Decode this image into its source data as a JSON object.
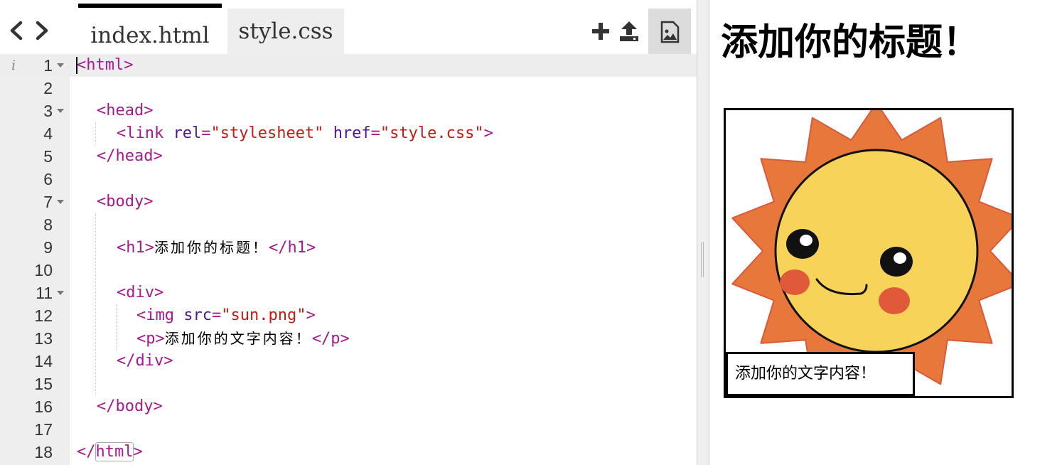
{
  "editor": {
    "tabs": [
      {
        "label": "index.html",
        "active": true
      },
      {
        "label": "style.css",
        "active": false
      }
    ],
    "toolbar": {
      "back_icon": "chevron-left-icon",
      "forward_icon": "chevron-right-icon",
      "add_icon": "plus-icon",
      "upload_icon": "upload-icon",
      "image_icon": "image-icon"
    },
    "info_marker": "i",
    "lines": [
      {
        "num": "1"
      },
      {
        "num": "2"
      },
      {
        "num": "3"
      },
      {
        "num": "4"
      },
      {
        "num": "5"
      },
      {
        "num": "6"
      },
      {
        "num": "7"
      },
      {
        "num": "8"
      },
      {
        "num": "9"
      },
      {
        "num": "10"
      },
      {
        "num": "11"
      },
      {
        "num": "12"
      },
      {
        "num": "13"
      },
      {
        "num": "14"
      },
      {
        "num": "15"
      },
      {
        "num": "16"
      },
      {
        "num": "17"
      },
      {
        "num": "18"
      }
    ],
    "code": {
      "l1_open": "<html>",
      "l3_head": "<head>",
      "l4_link_open": "<link",
      "l4_rel_attr": "rel",
      "l4_eq1": "=",
      "l4_rel_val": "\"stylesheet\"",
      "l4_href_attr": "href",
      "l4_eq2": "=",
      "l4_href_val": "\"style.css\"",
      "l4_close": ">",
      "l5_head_close": "</head>",
      "l7_body": "<body>",
      "l9_h1_open": "<h1>",
      "l9_h1_text": "添加你的标题！",
      "l9_h1_close": "</h1>",
      "l11_div": "<div>",
      "l12_img_open": "<img",
      "l12_src_attr": "src",
      "l12_eq": "=",
      "l12_src_val": "\"sun.png\"",
      "l12_close": ">",
      "l13_p_open": "<p>",
      "l13_p_text": "添加你的文字内容！",
      "l13_p_close": "</p>",
      "l14_div_close": "</div>",
      "l16_body_close": "</body>",
      "l18_open": "</",
      "l18_name": "html",
      "l18_close": ">"
    }
  },
  "preview": {
    "heading": "添加你的标题！",
    "image_alt": "sun.png",
    "caption": "添加你的文字内容！"
  },
  "colors": {
    "tag": "#a8198d",
    "attribute": "#4c1a86",
    "string": "#c41a16",
    "sun_outer": "#e8773b",
    "sun_face": "#f8d35a",
    "cheek": "#e05a3a"
  }
}
